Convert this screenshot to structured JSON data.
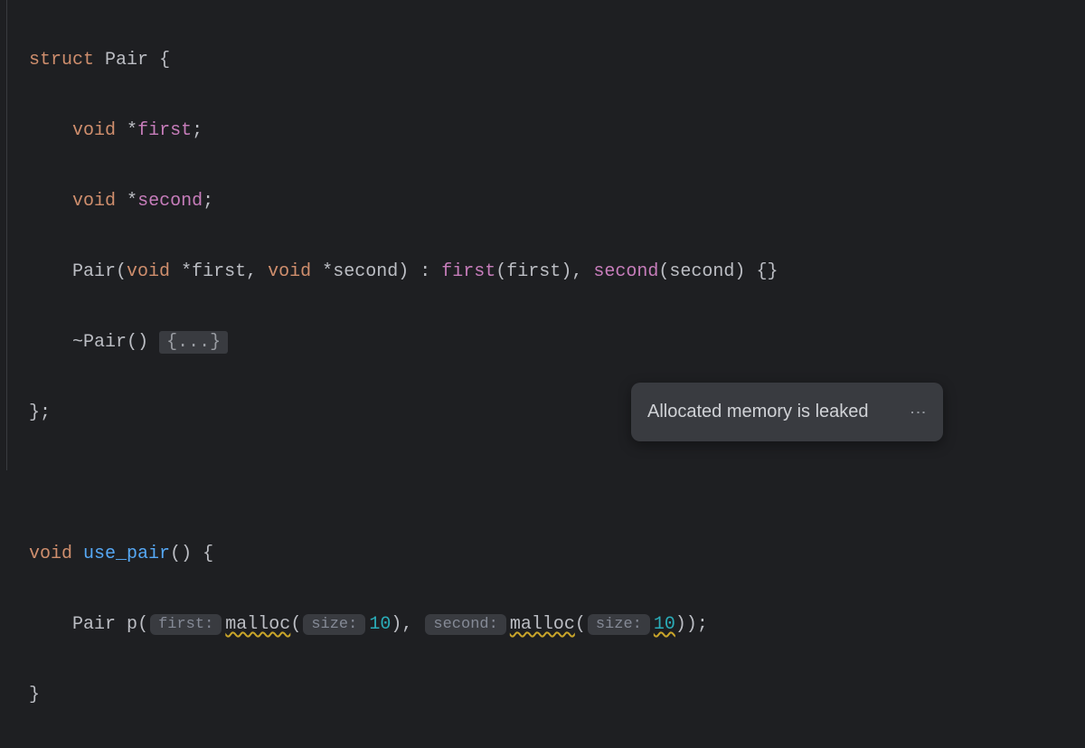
{
  "code": {
    "kw_struct": "struct",
    "type_Pair": "Pair",
    "brace_open": "{",
    "brace_close": "}",
    "semicolon": ";",
    "kw_void": "void",
    "star": "*",
    "field_first": "first",
    "field_second": "second",
    "ctor_name": "Pair",
    "paren_open": "(",
    "paren_close": ")",
    "comma": ",",
    "colon": ":",
    "init_first": "first",
    "init_second": "second",
    "braces_empty": "{}",
    "tilde": "~",
    "dtor_name": "Pair",
    "collapsed_body": "{...}",
    "func_name": "use_pair",
    "var_p": "p",
    "call_malloc": "malloc",
    "arg_10a": "10",
    "arg_10b": "10"
  },
  "hints": {
    "first": "first:",
    "size1": "size:",
    "second": "second:",
    "size2": "size:"
  },
  "tooltip": {
    "text": "Allocated memory is leaked",
    "more": "⋮"
  }
}
